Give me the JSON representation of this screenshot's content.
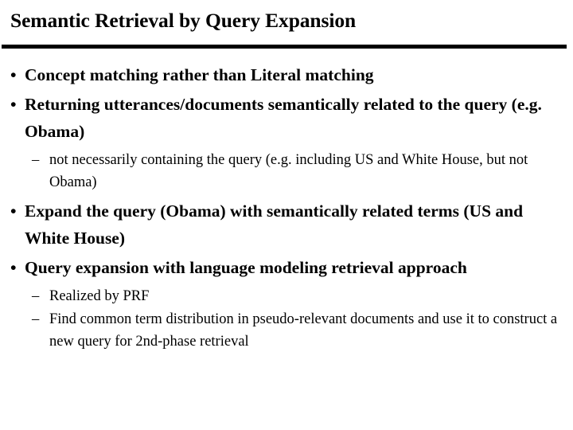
{
  "slide": {
    "title": "Semantic Retrieval by Query Expansion",
    "bullet_marker": "•",
    "sub_bullet_marker": "–",
    "rule_color": "#000000",
    "text_color": "#000000",
    "background_color": "#ffffff",
    "items": [
      {
        "level": 1,
        "text": "Concept matching rather than Literal matching"
      },
      {
        "level": 1,
        "text": "Returning utterances/documents semantically related to the query (e.g. Obama)"
      },
      {
        "level": 2,
        "text": "not necessarily containing the query (e.g. including US and White House, but not Obama)"
      },
      {
        "level": 1,
        "text": "Expand the query (Obama) with semantically related terms (US and White House)"
      },
      {
        "level": 1,
        "text": "Query expansion with language modeling retrieval approach"
      },
      {
        "level": 2,
        "text": "Realized by PRF"
      },
      {
        "level": 2,
        "text": "Find common term distribution in pseudo-relevant documents and use it to construct a new query for 2nd-phase retrieval"
      }
    ]
  }
}
